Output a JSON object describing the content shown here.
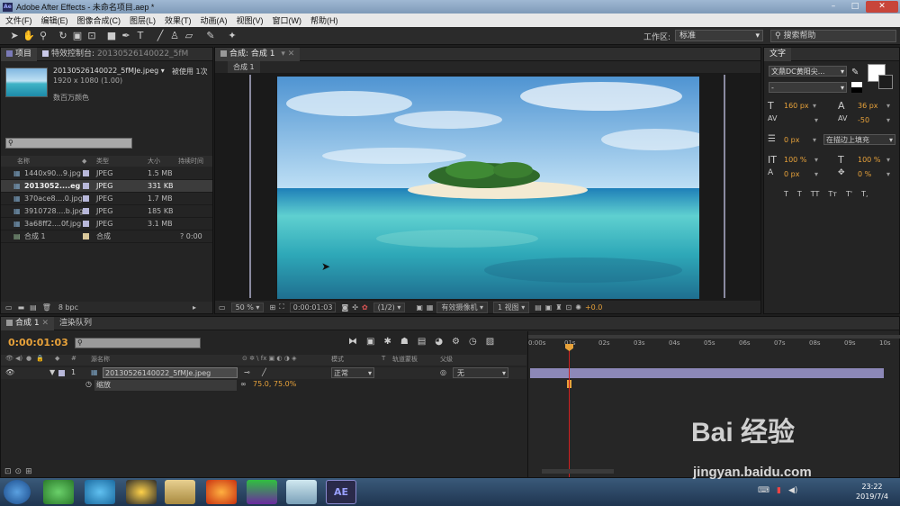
{
  "titlebar": {
    "title": "Adobe After Effects - 未命名项目.aep *"
  },
  "menu": [
    "文件(F)",
    "编辑(E)",
    "图像合成(C)",
    "图层(L)",
    "效果(T)",
    "动画(A)",
    "视图(V)",
    "窗口(W)",
    "帮助(H)"
  ],
  "toolbar": {
    "workspace_label": "工作区:",
    "workspace_value": "标准",
    "search_help": "搜索帮助"
  },
  "project_panel": {
    "tab_project": "项目",
    "tab_effects": "特效控制台:",
    "tab_effects_file": "20130526140022_5fM",
    "file_name": "20130526140022_5fMJe.jpeg ▾",
    "used": "被使用 1次",
    "dims": "1920 x 1080 (1.00)",
    "colors": "数百万颜色",
    "col_name": "名称",
    "col_type": "类型",
    "col_size": "大小",
    "col_duration": "持续时间",
    "items": [
      {
        "name": "1440x90...9.jpg",
        "type": "JPEG",
        "size": "1.5 MB",
        "dur": ""
      },
      {
        "name": "2013052....eg",
        "type": "JPEG",
        "size": "331 KB",
        "dur": ""
      },
      {
        "name": "370ace8....0.jpg",
        "type": "JPEG",
        "size": "1.7 MB",
        "dur": ""
      },
      {
        "name": "3910728....b.jpg",
        "type": "JPEG",
        "size": "185 KB",
        "dur": ""
      },
      {
        "name": "3a68ff2....0f.jpg",
        "type": "JPEG",
        "size": "3.1 MB",
        "dur": ""
      },
      {
        "name": "合成 1",
        "type": "合成",
        "size": "",
        "dur": "? 0:00"
      }
    ],
    "bpc": "8 bpc"
  },
  "comp_panel": {
    "tab": "合成: 合成 1",
    "sub_tab": "合成 1",
    "zoom": "50 %",
    "time": "0:00:01:03",
    "resolution": "(1/2)",
    "camera": "有效摄像机",
    "views": "1 视图",
    "exposure": "+0.0"
  },
  "text_panel": {
    "tab": "文字",
    "font": "文鼎DC黄阳尖...",
    "font_style": "-",
    "size": "160 px",
    "leading": "36 px",
    "kerning": "-50",
    "stroke": "0 px",
    "stroke_mode": "在描边上填充",
    "vscale": "100 %",
    "hscale": "100 %",
    "baseline": "0 px",
    "tsume": "0 %",
    "style_buttons": [
      "T",
      "T",
      "TT",
      "Tт",
      "T'",
      "T,"
    ]
  },
  "timeline": {
    "tab_comp": "合成 1",
    "tab_render": "渲染队列",
    "timecode": "0:00:01:03",
    "col_source": "源名称",
    "col_mode": "模式",
    "col_t": "T",
    "col_trkmat": "轨道蒙板",
    "col_parent": "父级",
    "layer_num": "1",
    "layer_name": "20130526140022_5fMJe.jpeg",
    "layer_mode": "正常",
    "layer_parent": "无",
    "prop_name": "缩放",
    "prop_value": "75.0, 75.0%",
    "ruler": [
      "0:00s",
      "01s",
      "02s",
      "03s",
      "04s",
      "05s",
      "06s",
      "07s",
      "08s",
      "09s",
      "10s"
    ]
  },
  "taskbar": {
    "time": "23:22",
    "date": "2019/7/4",
    "ae_label": "AE"
  },
  "watermark": {
    "brand": "Bai 经验",
    "url": "jingyan.baidu.com"
  },
  "colors": {
    "accent": "#e8a23a",
    "playhead": "#d02020",
    "layer_bar": "#8c88b8"
  }
}
